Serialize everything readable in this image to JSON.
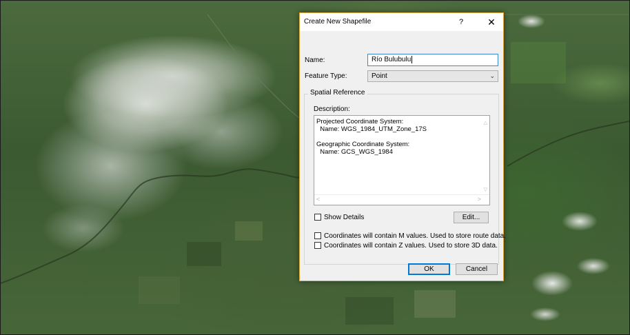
{
  "dialog": {
    "title": "Create New Shapefile",
    "help_label": "?",
    "close_label": "✕",
    "name_label": "Name:",
    "name_value": "Río Bulubulu",
    "feature_type_label": "Feature Type:",
    "feature_type_value": "Point",
    "spatial_reference_label": "Spatial Reference",
    "description_label": "Description:",
    "description_text": "Projected Coordinate System:\n  Name: WGS_1984_UTM_Zone_17S\n\nGeographic Coordinate System:\n  Name: GCS_WGS_1984",
    "show_details_label": "Show Details",
    "edit_label": "Edit...",
    "m_values_label": "Coordinates will contain M values. Used to store route data.",
    "z_values_label": "Coordinates will contain Z values. Used to store 3D data.",
    "ok_label": "OK",
    "cancel_label": "Cancel"
  },
  "colors": {
    "dialog_border": "#e0a437",
    "input_focus": "#3c87cf",
    "default_button": "#0078d7"
  },
  "icons": {
    "select_arrow": "chevron-down-icon",
    "scroll_up": "scroll-up-icon",
    "scroll_down": "scroll-down-icon",
    "scroll_left": "scroll-left-icon",
    "scroll_right": "scroll-right-icon"
  }
}
